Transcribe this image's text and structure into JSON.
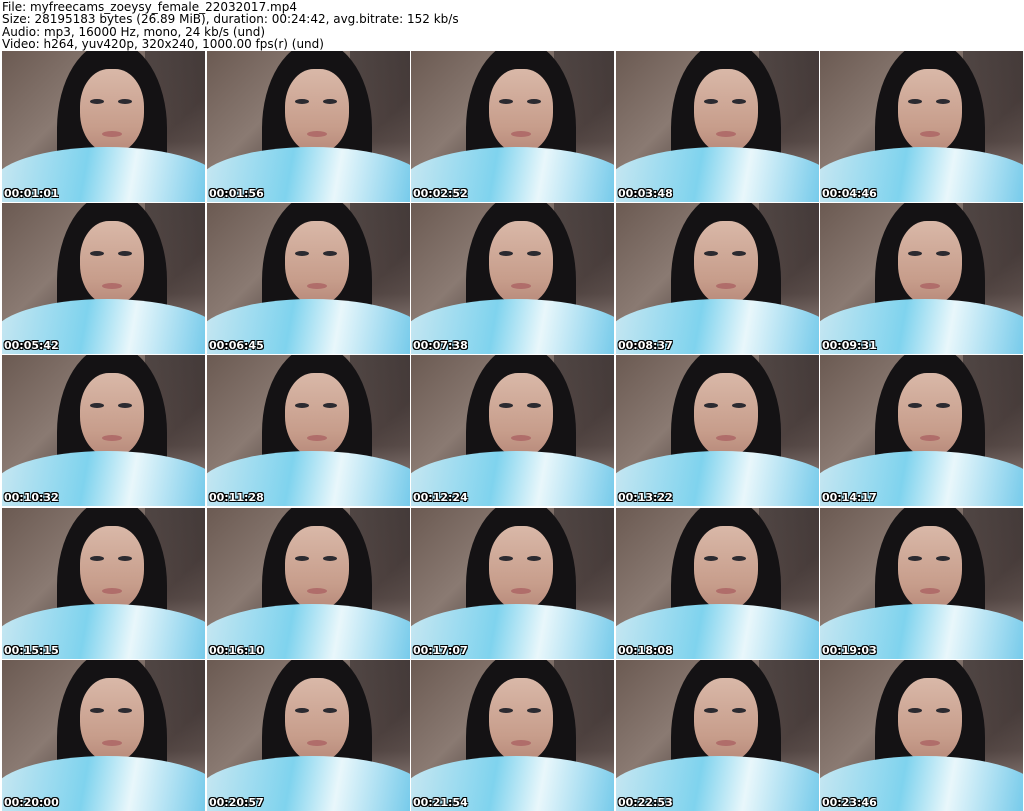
{
  "header": {
    "line1": "File: myfreecams_zoeysy_female_22032017.mp4",
    "line2": "Size: 28195183 bytes (26.89 MiB), duration: 00:24:42, avg.bitrate: 152 kb/s",
    "line3": "Audio: mp3, 16000 Hz, mono, 24 kb/s (und)",
    "line4": "Video: h264, yuv420p, 320x240, 1000.00 fps(r) (und)"
  },
  "thumbnails": [
    {
      "timestamp": "00:01:01"
    },
    {
      "timestamp": "00:01:56"
    },
    {
      "timestamp": "00:02:52"
    },
    {
      "timestamp": "00:03:48"
    },
    {
      "timestamp": "00:04:46"
    },
    {
      "timestamp": "00:05:42"
    },
    {
      "timestamp": "00:06:45"
    },
    {
      "timestamp": "00:07:38"
    },
    {
      "timestamp": "00:08:37"
    },
    {
      "timestamp": "00:09:31"
    },
    {
      "timestamp": "00:10:32"
    },
    {
      "timestamp": "00:11:28"
    },
    {
      "timestamp": "00:12:24"
    },
    {
      "timestamp": "00:13:22"
    },
    {
      "timestamp": "00:14:17"
    },
    {
      "timestamp": "00:15:15"
    },
    {
      "timestamp": "00:16:10"
    },
    {
      "timestamp": "00:17:07"
    },
    {
      "timestamp": "00:18:08"
    },
    {
      "timestamp": "00:19:03"
    },
    {
      "timestamp": "00:20:00"
    },
    {
      "timestamp": "00:20:57"
    },
    {
      "timestamp": "00:21:54"
    },
    {
      "timestamp": "00:22:53"
    },
    {
      "timestamp": "00:23:46"
    }
  ]
}
